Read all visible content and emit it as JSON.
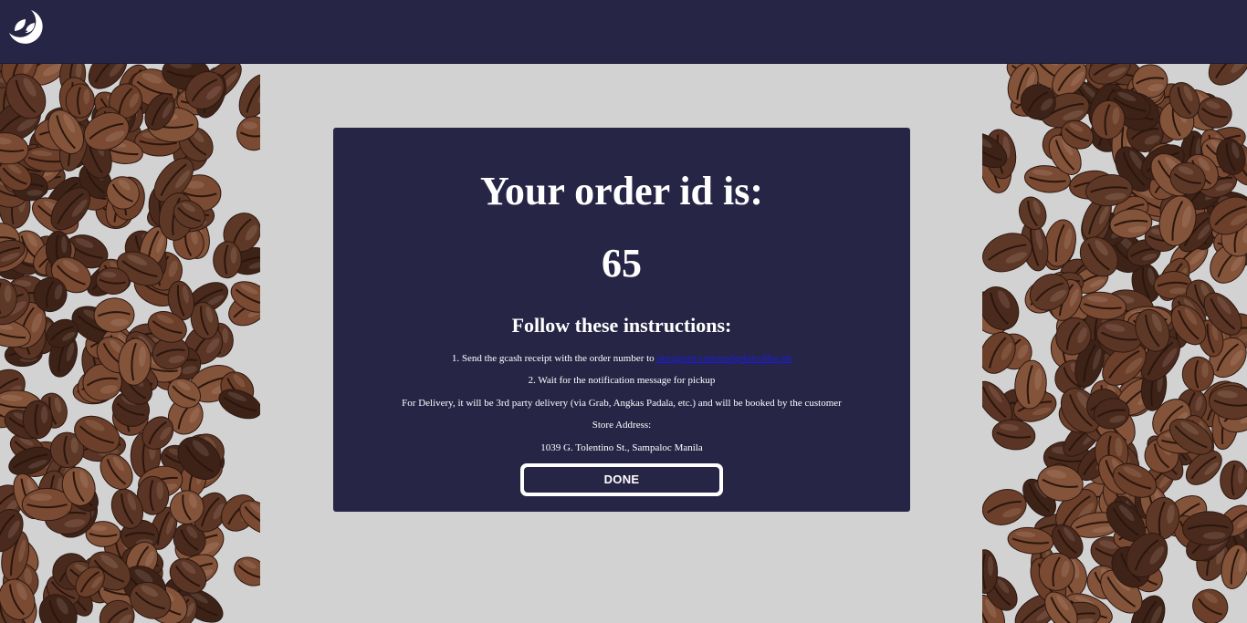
{
  "header": {
    "logo_icon": "leaf-moon-logo-icon"
  },
  "card": {
    "title": "Your order id is:",
    "order_id": "65",
    "instructions_heading": "Follow these instructions:",
    "step1_text": "1. Send the gcash receipt with the order number to ",
    "step1_link": "instagram.com/nudgebitcoffee.ph",
    "step2_text": "2. Wait for the notification message for pickup",
    "delivery_note": "For Delivery, it will be 3rd party delivery (via Grab, Angkas Padala, etc.) and will be booked by the customer",
    "store_address_label": "Store Address:",
    "store_address": "1039 G. Tolentino St., Sampaloc Manila",
    "done_label": "DONE"
  },
  "colors": {
    "navy": "#272545",
    "background": "#d3d2d2",
    "link": "#1a1aee"
  }
}
